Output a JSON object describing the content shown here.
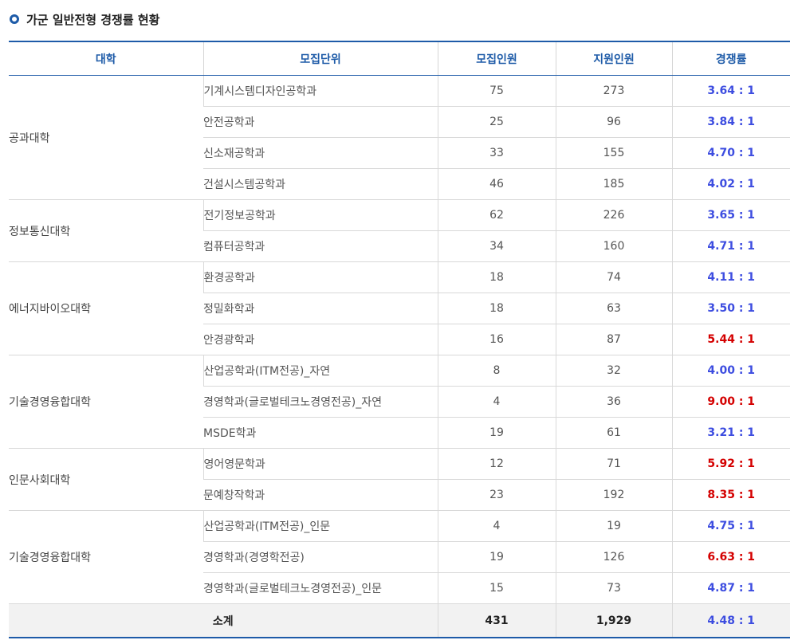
{
  "title": "가군 일반전형 경쟁률 현황",
  "columns": [
    "대학",
    "모집단위",
    "모집인원",
    "지원인원",
    "경쟁률"
  ],
  "groups": [
    {
      "college": "공과대학",
      "rows": [
        {
          "unit": "기계시스템디자인공학과",
          "quota": "75",
          "applicants": "273",
          "ratio": "3.64 : 1",
          "hl": "blue"
        },
        {
          "unit": "안전공학과",
          "quota": "25",
          "applicants": "96",
          "ratio": "3.84 : 1",
          "hl": "blue"
        },
        {
          "unit": "신소재공학과",
          "quota": "33",
          "applicants": "155",
          "ratio": "4.70 : 1",
          "hl": "blue"
        },
        {
          "unit": "건설시스템공학과",
          "quota": "46",
          "applicants": "185",
          "ratio": "4.02 : 1",
          "hl": "blue"
        }
      ]
    },
    {
      "college": "정보통신대학",
      "rows": [
        {
          "unit": "전기정보공학과",
          "quota": "62",
          "applicants": "226",
          "ratio": "3.65 : 1",
          "hl": "blue"
        },
        {
          "unit": "컴퓨터공학과",
          "quota": "34",
          "applicants": "160",
          "ratio": "4.71 : 1",
          "hl": "blue"
        }
      ]
    },
    {
      "college": "에너지바이오대학",
      "rows": [
        {
          "unit": "환경공학과",
          "quota": "18",
          "applicants": "74",
          "ratio": "4.11 : 1",
          "hl": "blue"
        },
        {
          "unit": "정밀화학과",
          "quota": "18",
          "applicants": "63",
          "ratio": "3.50 : 1",
          "hl": "blue"
        },
        {
          "unit": "안경광학과",
          "quota": "16",
          "applicants": "87",
          "ratio": "5.44 : 1",
          "hl": "red"
        }
      ]
    },
    {
      "college": "기술경영융합대학",
      "rows": [
        {
          "unit": "산업공학과(ITM전공)_자연",
          "quota": "8",
          "applicants": "32",
          "ratio": "4.00 : 1",
          "hl": "blue"
        },
        {
          "unit": "경영학과(글로벌테크노경영전공)_자연",
          "quota": "4",
          "applicants": "36",
          "ratio": "9.00 : 1",
          "hl": "red"
        },
        {
          "unit": "MSDE학과",
          "quota": "19",
          "applicants": "61",
          "ratio": "3.21 : 1",
          "hl": "blue"
        }
      ]
    },
    {
      "college": "인문사회대학",
      "rows": [
        {
          "unit": "영어영문학과",
          "quota": "12",
          "applicants": "71",
          "ratio": "5.92 : 1",
          "hl": "red"
        },
        {
          "unit": "문예창작학과",
          "quota": "23",
          "applicants": "192",
          "ratio": "8.35 : 1",
          "hl": "red"
        }
      ]
    },
    {
      "college": "기술경영융합대학",
      "rows": [
        {
          "unit": "산업공학과(ITM전공)_인문",
          "quota": "4",
          "applicants": "19",
          "ratio": "4.75 : 1",
          "hl": "blue"
        },
        {
          "unit": "경영학과(경영학전공)",
          "quota": "19",
          "applicants": "126",
          "ratio": "6.63 : 1",
          "hl": "red"
        },
        {
          "unit": "경영학과(글로벌테크노경영전공)_인문",
          "quota": "15",
          "applicants": "73",
          "ratio": "4.87 : 1",
          "hl": "blue"
        }
      ]
    }
  ],
  "total": {
    "label": "소계",
    "quota": "431",
    "applicants": "1,929",
    "ratio": "4.48 : 1",
    "hl": "blue"
  },
  "colors": {
    "header": "#1e5ba8",
    "ratio_blue": "#3d4de0",
    "ratio_red": "#d40000"
  },
  "icons": {
    "title_bullet": "circle-bullet-icon"
  }
}
